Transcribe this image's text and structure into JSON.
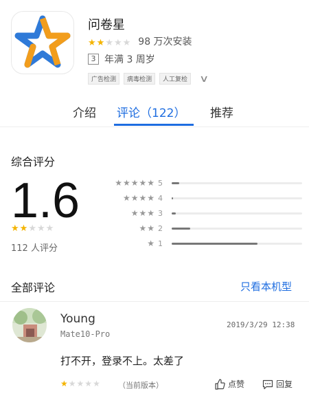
{
  "app": {
    "name": "问卷星",
    "rating_stars": 2,
    "max_stars": 5,
    "installs": "98 万次安装",
    "age_badge": "3",
    "age_text": "年满 3 周岁",
    "tags": [
      "广告检测",
      "病毒检测",
      "人工复检"
    ],
    "icon": "star-logo-icon",
    "colors": {
      "accent": "#1e6de0",
      "star": "#f4b400",
      "logo_blue": "#2f7ad8",
      "logo_orange": "#f29d1c"
    }
  },
  "tabs": [
    {
      "label": "介绍",
      "active": false
    },
    {
      "label": "评论（122）",
      "active": true
    },
    {
      "label": "推荐",
      "active": false
    }
  ],
  "overall": {
    "title": "综合评分",
    "score": "1.6",
    "stars": 2,
    "count_text": "112 人评分",
    "distribution": [
      {
        "stars": 5,
        "label": "5",
        "fraction": 0.06
      },
      {
        "stars": 4,
        "label": "4",
        "fraction": 0.01
      },
      {
        "stars": 3,
        "label": "3",
        "fraction": 0.03
      },
      {
        "stars": 2,
        "label": "2",
        "fraction": 0.14
      },
      {
        "stars": 1,
        "label": "1",
        "fraction": 0.66
      }
    ]
  },
  "reviews_section": {
    "title": "全部评论",
    "filter_link": "只看本机型"
  },
  "reviews": [
    {
      "user": "Young",
      "device": "Mate10-Pro",
      "time": "2019/3/29 12:38",
      "text": "打不开，登录不上。太差了",
      "stars": 1,
      "version": "（当前版本）",
      "like_label": "点赞",
      "reply_label": "回复"
    }
  ]
}
